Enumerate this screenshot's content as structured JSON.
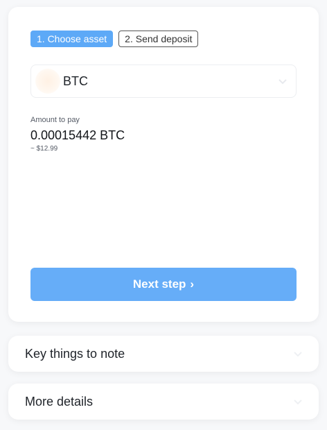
{
  "steps": [
    {
      "label": "1. Choose asset",
      "active": true
    },
    {
      "label": "2. Send deposit",
      "active": false
    }
  ],
  "asset": {
    "name": "BTC",
    "icon": "coin-icon"
  },
  "amount": {
    "label": "Amount to pay",
    "value": "0.00015442 BTC",
    "fiat": "~ $12.99"
  },
  "next_button": {
    "label": "Next step",
    "arrow": "›"
  },
  "sections": {
    "notes_label": "Key things to note",
    "details_label": "More details"
  },
  "colors": {
    "accent": "#5da9f7",
    "button": "#66adf8",
    "background": "#f7f8fa"
  }
}
